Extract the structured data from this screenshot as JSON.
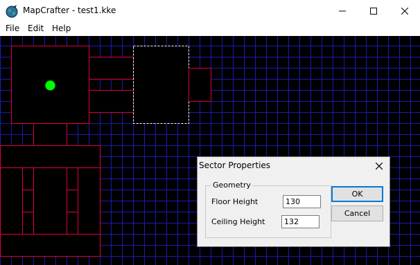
{
  "window": {
    "title": "MapCrafter - test1.kke",
    "controls": {
      "minimize_icon": "minimize-icon",
      "maximize_icon": "maximize-icon",
      "close_icon": "close-icon"
    }
  },
  "menu": {
    "items": [
      {
        "label": "File"
      },
      {
        "label": "Edit"
      },
      {
        "label": "Help"
      }
    ]
  },
  "map": {
    "background_color": "#000000",
    "grid_color": "#1a1ab4",
    "sector_line_color": "#e0003c",
    "selected_outline_color": "#ffffff",
    "player_color": "#00ff00"
  },
  "dialog": {
    "title": "Sector Properties",
    "group_label": "Geometry",
    "floor_label": "Floor Height",
    "floor_value": "130",
    "ceiling_label": "Ceiling Height",
    "ceiling_value": "132",
    "ok_label": "OK",
    "cancel_label": "Cancel"
  }
}
